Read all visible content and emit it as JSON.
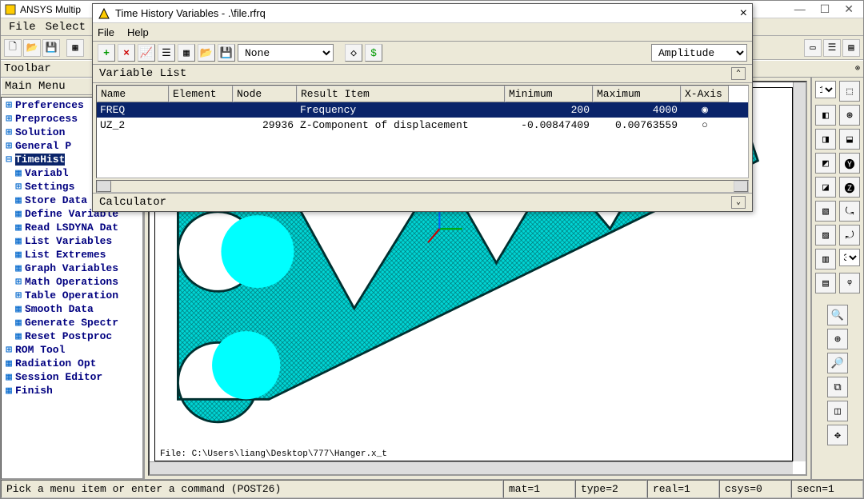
{
  "main_window": {
    "title": "ANSYS Multip",
    "menu": {
      "file": "File",
      "select": "Select"
    },
    "toolbar_label": "Toolbar",
    "main_menu_label": "Main Menu"
  },
  "tree": {
    "items": [
      {
        "glyph": "⊞",
        "label": "Preferences",
        "indent": 0,
        "sel": false
      },
      {
        "glyph": "⊞",
        "label": "Preprocess",
        "indent": 0,
        "sel": false
      },
      {
        "glyph": "⊞",
        "label": "Solution",
        "indent": 0,
        "sel": false
      },
      {
        "glyph": "⊞",
        "label": "General P",
        "indent": 0,
        "sel": false
      },
      {
        "glyph": "⊟",
        "label": "TimeHist",
        "indent": 0,
        "sel": true
      },
      {
        "glyph": "▦",
        "label": "Variabl",
        "indent": 1,
        "sel": false
      },
      {
        "glyph": "⊞",
        "label": "Settings",
        "indent": 1,
        "sel": false
      },
      {
        "glyph": "▦",
        "label": "Store Data",
        "indent": 1,
        "sel": false
      },
      {
        "glyph": "▦",
        "label": "Define Variable",
        "indent": 1,
        "sel": false
      },
      {
        "glyph": "▦",
        "label": "Read LSDYNA Dat",
        "indent": 1,
        "sel": false
      },
      {
        "glyph": "▦",
        "label": "List Variables",
        "indent": 1,
        "sel": false
      },
      {
        "glyph": "▦",
        "label": "List Extremes",
        "indent": 1,
        "sel": false
      },
      {
        "glyph": "▦",
        "label": "Graph Variables",
        "indent": 1,
        "sel": false
      },
      {
        "glyph": "⊞",
        "label": "Math Operations",
        "indent": 1,
        "sel": false
      },
      {
        "glyph": "⊞",
        "label": "Table Operation",
        "indent": 1,
        "sel": false
      },
      {
        "glyph": "▦",
        "label": "Smooth Data",
        "indent": 1,
        "sel": false
      },
      {
        "glyph": "▦",
        "label": "Generate Spectr",
        "indent": 1,
        "sel": false
      },
      {
        "glyph": "▦",
        "label": "Reset Postproc",
        "indent": 1,
        "sel": false
      },
      {
        "glyph": "⊞",
        "label": "ROM Tool",
        "indent": 0,
        "sel": false
      },
      {
        "glyph": "▦",
        "label": "Radiation Opt",
        "indent": 0,
        "sel": false
      },
      {
        "glyph": "▦",
        "label": "Session Editor",
        "indent": 0,
        "sel": false
      },
      {
        "glyph": "▦",
        "label": "Finish",
        "indent": 0,
        "sel": false
      }
    ]
  },
  "viewport": {
    "file_caption": "File: C:\\Users\\liang\\Desktop\\777\\Hanger.x_t"
  },
  "status": {
    "prompt": "Pick a menu item or enter a command (POST26)",
    "mat": "mat=1",
    "type": "type=2",
    "real": "real=1",
    "csys": "csys=0",
    "secn": "secn=1"
  },
  "dialog": {
    "title": "Time History Variables - .\\file.rfrq",
    "menu": {
      "file": "File",
      "help": "Help"
    },
    "toolbar_select_left": "None",
    "toolbar_select_right": "Amplitude",
    "section_varlist": "Variable List",
    "section_calc": "Calculator",
    "columns": {
      "name": "Name",
      "element": "Element",
      "node": "Node",
      "result": "Result Item",
      "min": "Minimum",
      "max": "Maximum",
      "xaxis": "X-Axis"
    },
    "rows": [
      {
        "name": "FREQ",
        "element": "",
        "node": "",
        "result": "Frequency",
        "min": "200",
        "max": "4000",
        "xsel": true
      },
      {
        "name": "UZ_2",
        "element": "",
        "node": "29936",
        "result": "Z-Component of displacement",
        "min": "-0.00847409",
        "max": "0.00763559",
        "xsel": false
      }
    ]
  },
  "right_select": {
    "top": "1",
    "mid": "3"
  }
}
